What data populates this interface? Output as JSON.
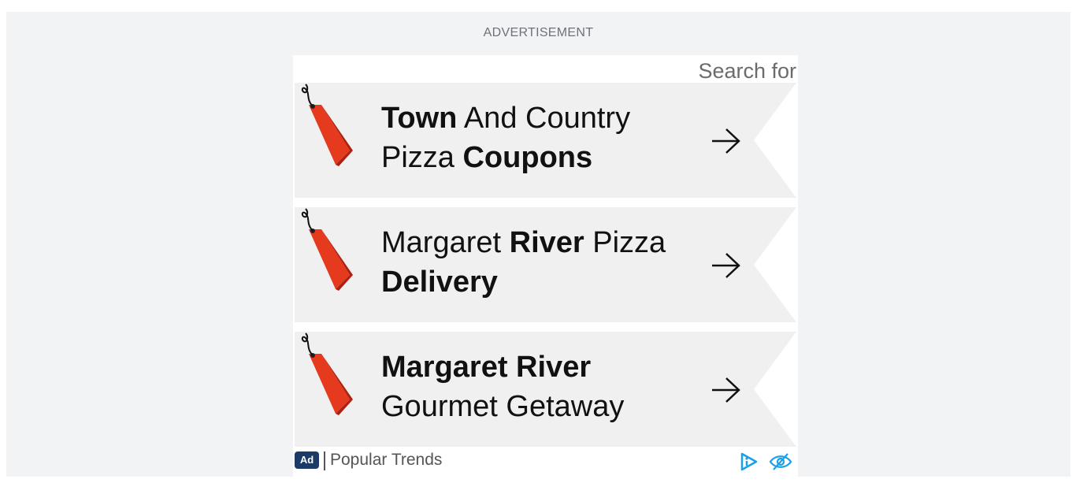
{
  "ad_header": {
    "label": "ADVERTISEMENT"
  },
  "ad_unit": {
    "search_for": "Search for",
    "items": [
      {
        "parts": [
          {
            "text": "Town",
            "bold": true
          },
          {
            "text": " And Country Pizza ",
            "bold": false
          },
          {
            "text": "Coupons",
            "bold": true
          }
        ]
      },
      {
        "parts": [
          {
            "text": "Margaret ",
            "bold": false
          },
          {
            "text": "River",
            "bold": true
          },
          {
            "text": " Pizza ",
            "bold": false
          },
          {
            "text": "Delivery",
            "bold": true
          }
        ]
      },
      {
        "parts": [
          {
            "text": "Margaret River",
            "bold": true
          },
          {
            "text": " Gourmet Getaway",
            "bold": false
          }
        ]
      }
    ],
    "footer": {
      "badge": "Ad",
      "source": "Popular Trends"
    }
  },
  "colors": {
    "page_bg": "#f2f3f5",
    "item_bg": "#f0f0f0",
    "tag_red": "#e53a1e",
    "tag_dark": "#b02010",
    "badge_bg": "#1c3a66",
    "adchoices_blue": "#1aa0e8"
  },
  "icons": {
    "tag": "price-tag-icon",
    "arrow": "arrow-right-icon",
    "adchoices": "adchoices-icon",
    "hide": "eye-slash-icon"
  }
}
